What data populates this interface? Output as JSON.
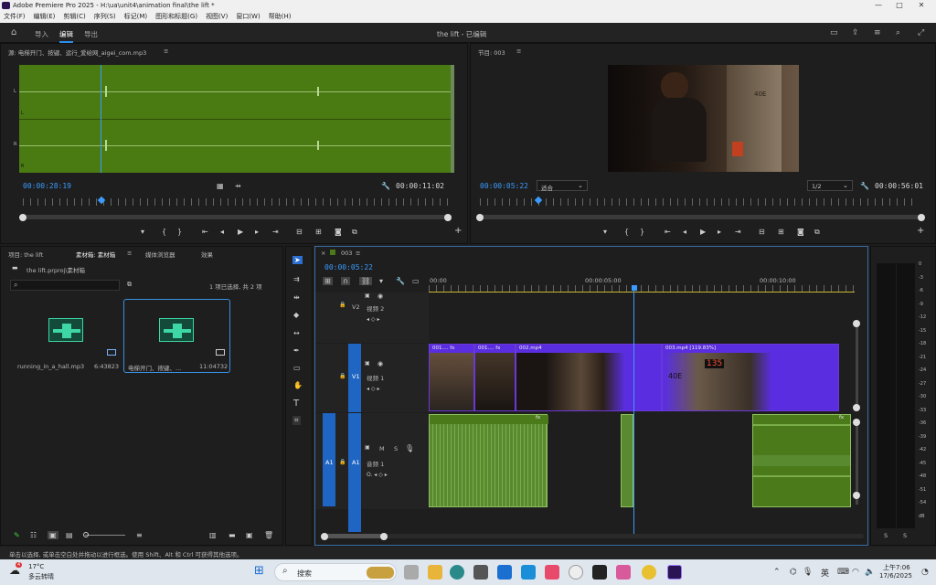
{
  "window": {
    "title": "Adobe Premiere Pro 2025 - H:\\ua\\unit4\\animation final\\the lift *",
    "min": "—",
    "max": "□",
    "close": "✕"
  },
  "menu": [
    "文件(F)",
    "编辑(E)",
    "剪辑(C)",
    "序列(S)",
    "标记(M)",
    "图形和标题(G)",
    "视图(V)",
    "窗口(W)",
    "帮助(H)"
  ],
  "header": {
    "tabs": [
      "导入",
      "编辑",
      "导出"
    ],
    "project_title": "the lift - 已编辑"
  },
  "source": {
    "title": "源: 电梯开门、按键、运行_爱给网_aigei_com.mp3",
    "menu": "≡",
    "ch_left": "L",
    "ch_right": "R",
    "timecode": "00:00:28:19",
    "duration": "00:00:11:02"
  },
  "program": {
    "title": "节目: 003",
    "menu": "≡",
    "timecode": "00:00:05:22",
    "fit": "适合",
    "quality": "1/2",
    "duration": "00:00:56:01",
    "frame_text": "40E"
  },
  "project": {
    "tabs": [
      "项目: the lift",
      "素材箱: 素材箱",
      "媒体浏览器",
      "效果"
    ],
    "path": "the lift.prproj\\素材箱",
    "status": "1 项已选择, 共 2 项",
    "items": [
      {
        "name": "running_in_a_hall.mp3",
        "dur": "6:43823"
      },
      {
        "name": "电梯开门、按键、...",
        "dur": "11:04732"
      }
    ]
  },
  "timeline": {
    "tab": "003",
    "timecode": "00:00:05:22",
    "ruler": [
      "00:00",
      "00:00:05:00",
      "00:00:10:00"
    ],
    "tracks": {
      "v2": "V2",
      "v2_name": "视频 2",
      "v1": "V1",
      "v1_name": "视频 1",
      "a1": "A1",
      "a1_name": "音频 1",
      "src_v1": "V1",
      "src_a1": "A1",
      "m": "M",
      "s": "S"
    },
    "clips": {
      "c1": "001....",
      "c2": "001....",
      "c3": "002.mp4",
      "c4": "003.mp4 [119.83%]",
      "fx": "fx",
      "lcd": "135",
      "floor": "40E"
    }
  },
  "meter": {
    "labels": [
      "0",
      "-3",
      "-6",
      "-9",
      "-12",
      "-15",
      "-18",
      "-21",
      "-24",
      "-27",
      "-30",
      "-33",
      "-36",
      "-39",
      "-42",
      "-45",
      "-48",
      "-51",
      "-54",
      "dB"
    ],
    "s1": "S",
    "s2": "S"
  },
  "status_bar": "单击以选择, 或单击空白处并拖动以进行框选。使用 Shift、Alt 和 Ctrl 可获得其他选项。",
  "taskbar": {
    "temp": "17°C",
    "weather": "多云转晴",
    "badge": "4",
    "search": "搜索",
    "ime": "英",
    "time": "上午7:06",
    "date": "17/6/2025"
  },
  "colors": {
    "accent": "#2d8ceb",
    "audio": "#4a7a1a",
    "video": "#5a2ee0"
  }
}
